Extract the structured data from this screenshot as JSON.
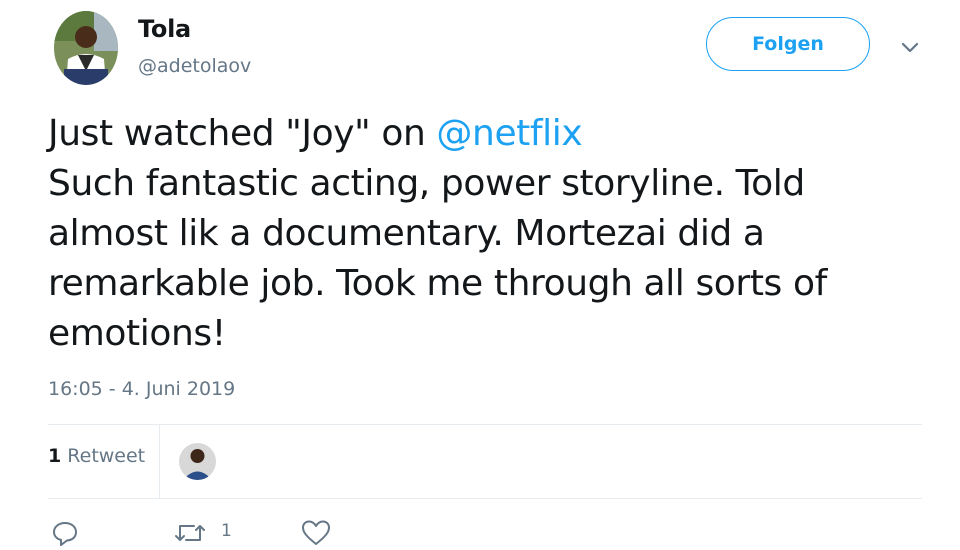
{
  "author": {
    "name": "Tola",
    "handle": "@adetolaov",
    "avatar_icon": "profile-photo"
  },
  "header": {
    "follow_label": "Folgen",
    "menu_icon": "chevron-down-icon"
  },
  "tweet": {
    "line1_pre": "Just watched \"Joy\" on ",
    "mention": "@netflix",
    "line2": "Such fantastic acting, power storyline. Told",
    "line3": "almost lik a documentary. Mortezai did a",
    "line4": "remarkable job. Took me through all sorts of",
    "line5": "emotions!"
  },
  "meta": {
    "timestamp": "16:05 - 4. Juni 2019"
  },
  "stats": {
    "retweet_count": "1",
    "retweet_label": "Retweet"
  },
  "actions": {
    "reply_icon": "reply-icon",
    "retweet_icon": "retweet-icon",
    "retweet_count": "1",
    "like_icon": "heart-icon"
  },
  "colors": {
    "accent": "#1da1f2",
    "text": "#14171a",
    "muted": "#657786",
    "divider": "#e6ecf0"
  }
}
